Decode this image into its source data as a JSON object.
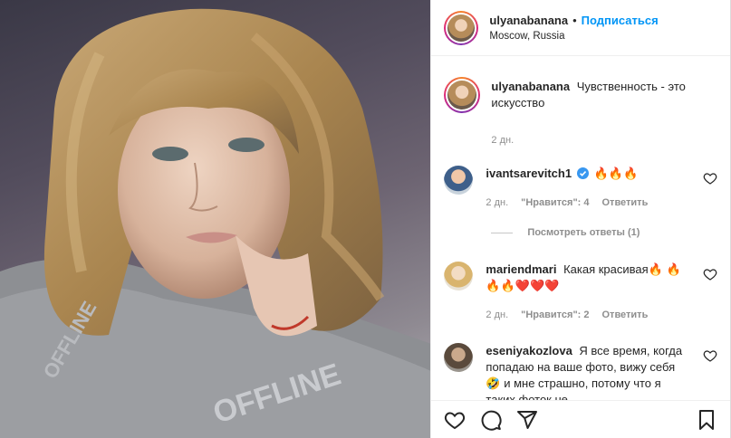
{
  "header": {
    "username": "ulyanabanana",
    "separator": "•",
    "follow_label": "Подписаться",
    "location": "Moscow, Russia"
  },
  "caption": {
    "username": "ulyanabanana",
    "text": "Чувственность - это искусство",
    "time": "2 дн."
  },
  "comments": [
    {
      "username": "ivantsarevitch1",
      "verified": true,
      "text": "🔥🔥🔥",
      "time": "2 дн.",
      "likes": "\"Нравится\": 4",
      "reply_label": "Ответить",
      "view_replies": "Посмотреть ответы (1)"
    },
    {
      "username": "mariendmari",
      "text": "Какая красивая🔥 🔥🔥🔥❤️❤️❤️",
      "time": "2 дн.",
      "likes": "\"Нравится\": 2",
      "reply_label": "Ответить"
    },
    {
      "username": "eseniyakozlova",
      "text": "Я все время, когда попадаю на ваше фото, вижу себя🤣 и мне страшно, потому что я таких фоток не"
    }
  ],
  "icons": {
    "like": "heart-icon",
    "comment": "comment-icon",
    "share": "share-icon",
    "save": "bookmark-icon"
  },
  "colors": {
    "link": "#0095f6",
    "muted": "#8e8e8e",
    "border": "#efefef"
  }
}
